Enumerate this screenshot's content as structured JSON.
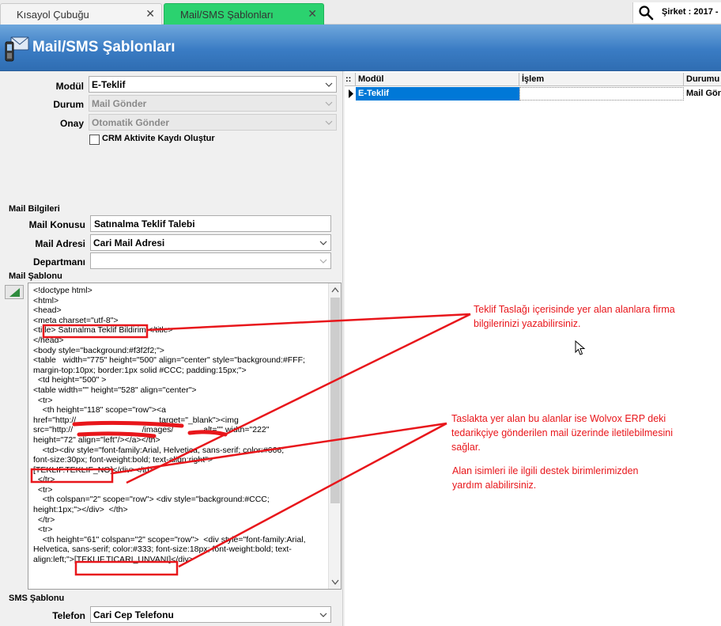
{
  "tabs": [
    {
      "label": "Kısayol Çubuğu",
      "close": "✕"
    },
    {
      "label": "Mail/SMS Şablonları",
      "close": "✕"
    }
  ],
  "topbar": {
    "company": "Şirket : 2017 -"
  },
  "header": {
    "title": "Mail/SMS Şablonları"
  },
  "form": {
    "modul": {
      "label": "Modül",
      "value": "E-Teklif"
    },
    "durum": {
      "label": "Durum",
      "value": "Mail Gönder"
    },
    "onay": {
      "label": "Onay",
      "value": "Otomatik Gönder"
    },
    "crm_checkbox": {
      "label": "CRM Aktivite Kaydı Oluştur"
    }
  },
  "mail": {
    "section": "Mail Bilgileri",
    "konu": {
      "label": "Mail Konusu",
      "value": "Satınalma Teklif Talebi"
    },
    "adres": {
      "label": "Mail Adresi",
      "value": "Cari Mail Adresi"
    },
    "departman": {
      "label": "Departmanı",
      "value": ""
    },
    "template_section": "Mail Şablonu",
    "template_code": "<!doctype html>\n<html>\n<head>\n<meta charset=\"utf-8\">\n<title> Satınalma Teklif Bildirimi</title>\n</head>\n<body style=\"background:#f3f2f2;\">\n<table   width=\"775\" height=\"500\" align=\"center\" style=\"background:#FFF;\nmargin-top:10px; border:1px solid #CCC; padding:15px;\">\n  <td height=\"500\" >\n<table width=\"\" height=\"528\" align=\"center\">\n  <tr>\n    <th height=\"118\" scope=\"row\"><a\nhref=\"http://                                    target=\"_blank\"><img\nsrc=\"http://                              /images/             alt=\"\" width=\"222\"\nheight=\"72\" align=\"left\"/></a></th>\n    <td><div style=\"font-family:Arial, Helvetica, sans-serif; color:#666;\nfont-size:30px; font-weight:bold; text-align:right\">\n[TEKLIF.TEKLIF_NO]</div></td>\n  </tr>\n  <tr>\n    <th colspan=\"2\" scope=\"row\"> <div style=\"background:#CCC;\nheight:1px;\"></div>  </th>\n  </tr>\n  <tr>\n    <th height=\"61\" colspan=\"2\" scope=\"row\">  <div style=\"font-family:Arial,\nHelvetica, sans-serif; color:#333; font-size:18px; font-weight:bold; text-\nalign:left;\">[TEKLIF.TICARI_UNVANI]</div>"
  },
  "sms": {
    "section": "SMS Şablonu",
    "telefon": {
      "label": "Telefon",
      "value": "Cari Cep Telefonu"
    }
  },
  "grid": {
    "indicator": "::",
    "columns": [
      "Modül",
      "İşlem",
      "Durumu"
    ],
    "rows": [
      {
        "modul": "E-Teklif",
        "islem": "",
        "durumu": "Mail Gön"
      }
    ]
  },
  "annotations": {
    "note1": [
      "Teklif Taslağı içerisinde yer alan alanlara firma",
      "bilgilerinizi yazabilirsiniz."
    ],
    "note2": [
      "Taslakta yer alan bu alanlar ise Wolvox ERP deki",
      "tedarikçiye gönderilen mail üzerinde iletilebilmesini",
      "sağlar."
    ],
    "note3": [
      "Alan isimleri ile ilgili destek birimlerimizden",
      "yardım alabilirsiniz."
    ],
    "color": "#e8161b"
  },
  "colors": {
    "active_tab": "#2bd26f",
    "header": "#3a7cc4",
    "selection": "#0078d7"
  }
}
